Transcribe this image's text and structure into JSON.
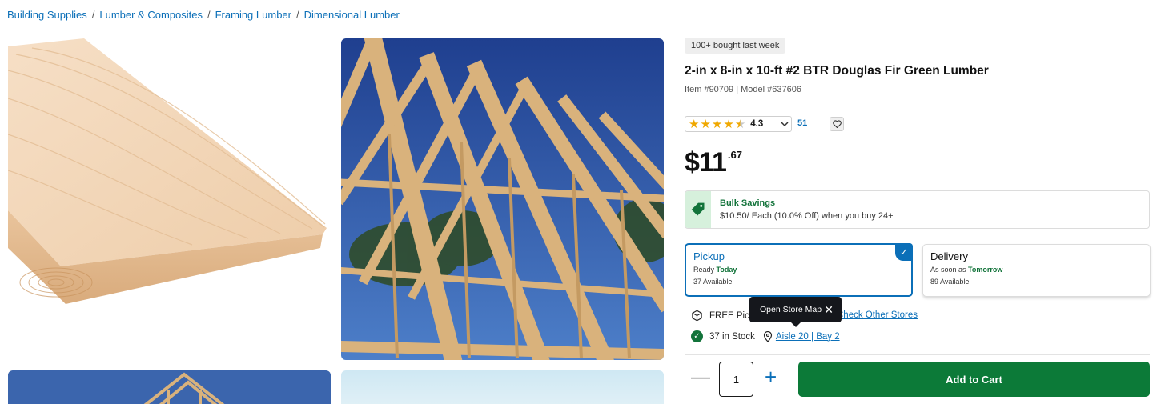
{
  "breadcrumb": [
    {
      "label": "Building Supplies"
    },
    {
      "label": "Lumber & Composites"
    },
    {
      "label": "Framing Lumber"
    },
    {
      "label": "Dimensional Lumber"
    }
  ],
  "gallery": {
    "images": [
      "lumber-board",
      "roof-trusses-sky",
      "roof-trusses-top",
      "sky-partial"
    ]
  },
  "product": {
    "badge": "100+ bought last week",
    "title": "2-in x 8-in x 10-ft #2 BTR Douglas Fir Green Lumber",
    "item_model": "Item #90709 | Model #637606",
    "rating": {
      "value": "4.3",
      "stars": 4.3,
      "review_count": "51"
    },
    "price": {
      "dollars": "$11",
      "cents": ".67"
    },
    "bulk_savings": {
      "title": "Bulk Savings",
      "description": "$10.50/ Each (10.0% Off) when you buy 24+"
    }
  },
  "fulfillment": {
    "pickup": {
      "title": "Pickup",
      "ready_prefix": "Ready ",
      "ready_when": "Today",
      "available": "37 Available",
      "selected": true
    },
    "delivery": {
      "title": "Delivery",
      "ready_prefix": "As soon as ",
      "ready_when": "Tomorrow",
      "available": "89 Available",
      "selected": false
    }
  },
  "store": {
    "free_pickup": "FREE Pick",
    "check_other_stores": "Check Other Stores",
    "stock": "37 in Stock",
    "aisle": "Aisle 20 | Bay 2"
  },
  "tooltip": {
    "label": "Open Store Map"
  },
  "cart": {
    "quantity": "1",
    "add_label": "Add to Cart"
  },
  "colors": {
    "link": "#0b6fb8",
    "green": "#0c7a38",
    "star": "#f0a800"
  },
  "icons": [
    "heart-icon",
    "chevron-down-icon",
    "tag-icon",
    "box-icon",
    "check-circle-icon",
    "map-pin-icon",
    "close-icon",
    "minus-icon",
    "plus-icon"
  ]
}
